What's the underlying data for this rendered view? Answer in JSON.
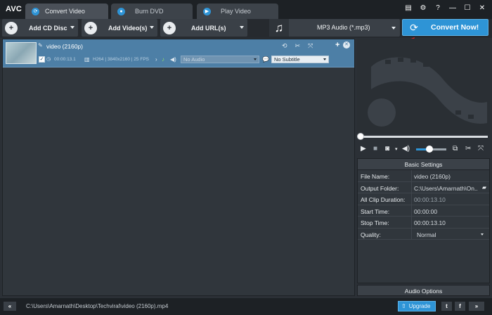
{
  "app": {
    "logo": "AVC"
  },
  "tabs": [
    {
      "label": "Convert Video",
      "icon": "refresh-icon",
      "active": true
    },
    {
      "label": "Burn DVD",
      "icon": "disc-icon",
      "active": false
    },
    {
      "label": "Play Video",
      "icon": "play-icon",
      "active": false
    }
  ],
  "window_controls": [
    "log-icon",
    "gear-icon",
    "help-icon",
    "minimize-icon",
    "maximize-icon",
    "close-icon"
  ],
  "toolbar": {
    "add_cd_label": "Add CD Disc",
    "add_video_label": "Add Video(s)",
    "add_url_label": "Add URL(s)",
    "format_label": "MP3 Audio (*.mp3)",
    "convert_label": "Convert Now!"
  },
  "file_row": {
    "name": "video (2160p)",
    "duration": "00:00:13.1",
    "video_info": "H264 | 3840x2160 | 25 FPS",
    "audio_value": "No Audio",
    "subtitle_value": "No Subtitle"
  },
  "settings": {
    "header": "Basic Settings",
    "rows": [
      {
        "label": "File Name:",
        "value": "video (2160p)"
      },
      {
        "label": "Output Folder:",
        "value": "C:\\Users\\Amarnath\\On..."
      },
      {
        "label": "All Clip Duration:",
        "value": "00:00:13.10"
      },
      {
        "label": "Start Time:",
        "value": "00:00:00"
      },
      {
        "label": "Stop Time:",
        "value": "00:00:13.10"
      },
      {
        "label": "Quality:",
        "value": "Normal"
      }
    ],
    "audio_options": "Audio Options"
  },
  "player": {
    "volume_level": 0.45,
    "seek_position": 0
  },
  "status": {
    "path": "C:\\Users\\Amarnath\\Desktop\\Techviral\\video (2160p).mp4",
    "upgrade_label": "Upgrade"
  },
  "colors": {
    "accent": "#2e94d6",
    "selected_row": "#4d7fa6",
    "background": "#2b3036"
  }
}
